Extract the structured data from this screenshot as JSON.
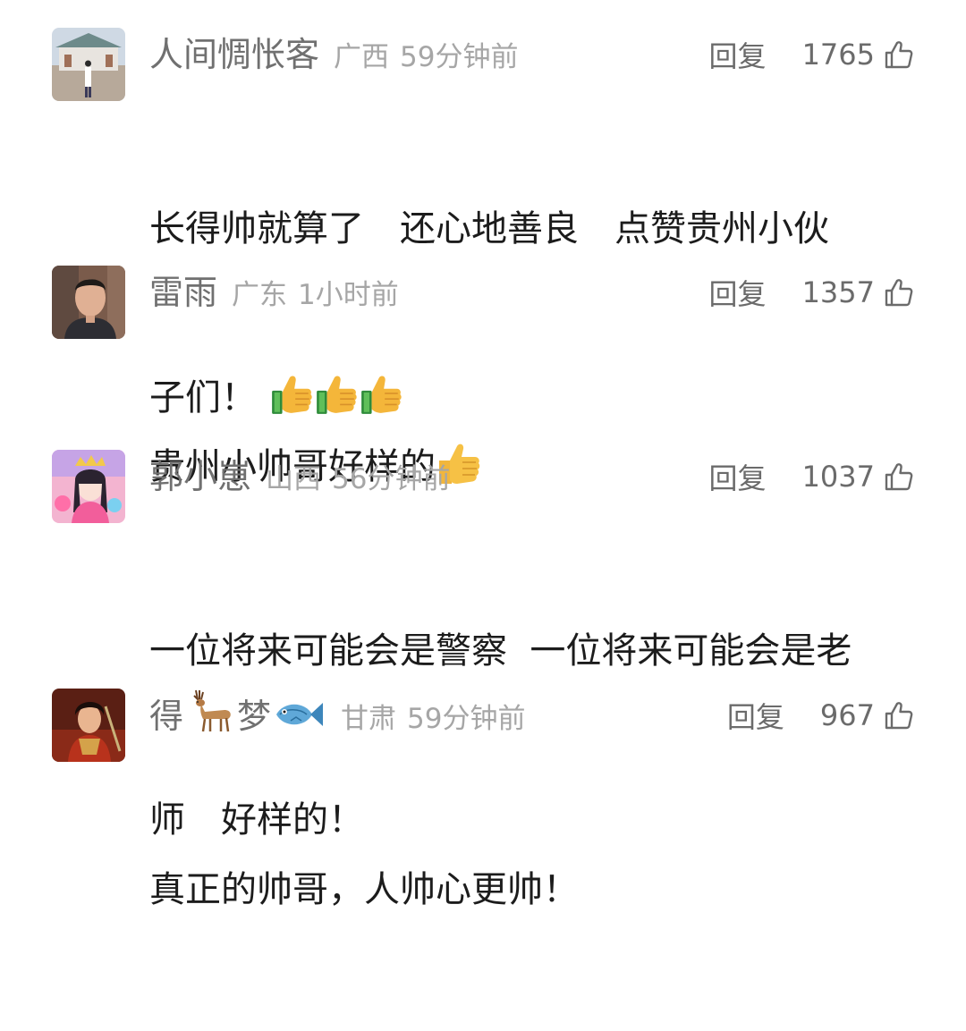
{
  "comments": [
    {
      "username": "人间惆怅客",
      "region": "广西",
      "time": "59分钟前",
      "reply_label": "回复",
      "likes": "1765",
      "text_line1": "长得帅就算了　还心地善良　点赞贵州小伙",
      "text_line2": "子们！",
      "emojis": [
        "thumbs-up",
        "thumbs-up",
        "thumbs-up"
      ]
    },
    {
      "username": "雷雨",
      "region": "广东",
      "time": "1小时前",
      "reply_label": "回复",
      "likes": "1357",
      "text_line1": "贵州小帅哥好样的",
      "emojis": [
        "thumbs-up"
      ]
    },
    {
      "username": "郭小崽",
      "region": "山西",
      "time": "56分钟前",
      "reply_label": "回复",
      "likes": "1037",
      "text_line1": "一位将来可能会是警察  一位将来可能会是老",
      "text_line2": "师　好样的！"
    },
    {
      "username_part1": "得",
      "username_part2": "梦",
      "username_emojis": [
        "deer",
        "fish"
      ],
      "region": "甘肃",
      "time": "59分钟前",
      "reply_label": "回复",
      "likes": "967",
      "text_line1": "真正的帅哥，人帅心更帅！"
    }
  ],
  "colors": {
    "username": "#707070",
    "meta": "#a6a6a6",
    "body_text": "#1c1c1c",
    "action": "#6b6b6b"
  }
}
